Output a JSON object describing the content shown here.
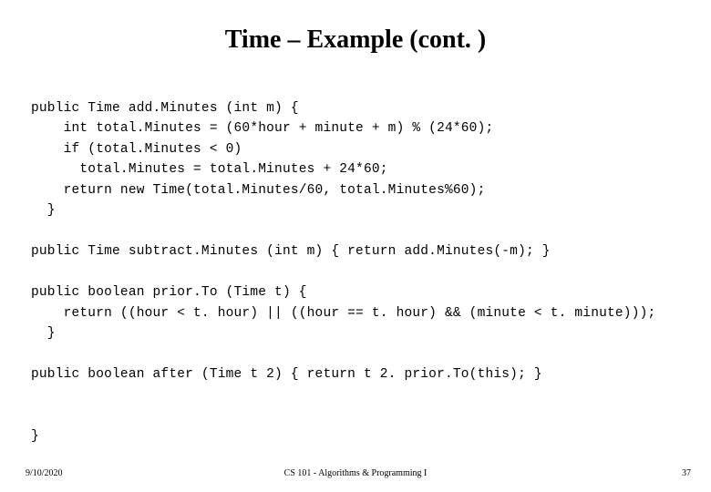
{
  "title": "Time – Example (cont. )",
  "code": "public Time add.Minutes (int m) {\n    int total.Minutes = (60*hour + minute + m) % (24*60);\n    if (total.Minutes < 0)\n      total.Minutes = total.Minutes + 24*60;\n    return new Time(total.Minutes/60, total.Minutes%60);\n  }\n\npublic Time subtract.Minutes (int m) { return add.Minutes(-m); }\n\npublic boolean prior.To (Time t) {\n    return ((hour < t. hour) || ((hour == t. hour) && (minute < t. minute)));\n  }\n\npublic boolean after (Time t 2) { return t 2. prior.To(this); }\n\n\n}",
  "footer": {
    "date": "9/10/2020",
    "course": "CS 101 - Algorithms & Programming I",
    "page": "37"
  }
}
